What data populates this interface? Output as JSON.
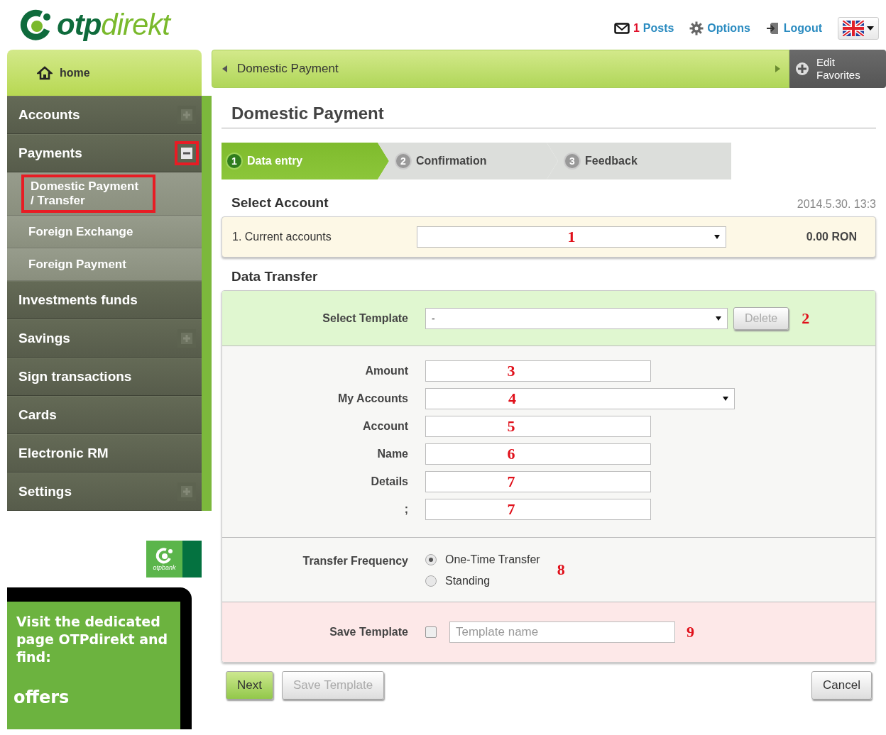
{
  "header": {
    "logo": {
      "mark": "otp",
      "word": "direkt"
    },
    "links": [
      {
        "kind": "posts",
        "count": "1",
        "label": "Posts"
      },
      {
        "kind": "options",
        "label": "Options"
      },
      {
        "kind": "logout",
        "label": "Logout"
      }
    ]
  },
  "sidebar": {
    "home": "home",
    "items": [
      {
        "label": "Accounts",
        "expandable": true,
        "expanded": false,
        "highlighted": false
      },
      {
        "label": "Payments",
        "expandable": true,
        "expanded": true,
        "highlighted": true,
        "children": [
          {
            "label": "Domestic Payment / Transfer",
            "highlighted": true
          },
          {
            "label": "Foreign Exchange",
            "highlighted": false
          },
          {
            "label": "Foreign Payment",
            "highlighted": false
          }
        ]
      },
      {
        "label": "Investments funds",
        "expandable": false,
        "expanded": false,
        "highlighted": false
      },
      {
        "label": "Savings",
        "expandable": true,
        "expanded": false,
        "highlighted": false
      },
      {
        "label": "Sign transactions",
        "expandable": false,
        "expanded": false,
        "highlighted": false
      },
      {
        "label": "Cards",
        "expandable": false,
        "expanded": false,
        "highlighted": false
      },
      {
        "label": "Electronic RM",
        "expandable": false,
        "expanded": false,
        "highlighted": false
      },
      {
        "label": "Settings",
        "expandable": true,
        "expanded": false,
        "highlighted": false
      }
    ],
    "bank_logo": "otpbank",
    "promo": {
      "text": "Visit the dedicated page OTPdirekt and find:",
      "cut_text": "offers"
    }
  },
  "breadcrumb": {
    "label": "Domestic Payment",
    "favorites": "Edit Favorites"
  },
  "page_title": "Domestic Payment",
  "steps": [
    {
      "number": "1",
      "label": "Data entry",
      "selected": true
    },
    {
      "number": "2",
      "label": "Confirmation",
      "selected": false
    },
    {
      "number": "3",
      "label": "Feedback",
      "selected": false
    }
  ],
  "select_account": {
    "title": "Select Account",
    "timestamp": "2014.5.30. 13:3",
    "account_label": "1. Current accounts",
    "annotation": "1",
    "balance": "0.00 RON"
  },
  "data_transfer": {
    "title": "Data Transfer",
    "template": {
      "label": "Select Template",
      "value": "-",
      "delete_button": "Delete",
      "delete_disabled": true,
      "annotation": "2"
    },
    "fields": [
      {
        "label": "Amount",
        "kind": "input",
        "annotation": "3"
      },
      {
        "label": "My Accounts",
        "kind": "select",
        "annotation": "4"
      },
      {
        "label": "Account",
        "kind": "input",
        "annotation": "5"
      },
      {
        "label": "Name",
        "kind": "input",
        "annotation": "6"
      },
      {
        "label": "Details",
        "kind": "input",
        "annotation": "7"
      },
      {
        "label": ";",
        "kind": "input",
        "annotation": "7"
      }
    ],
    "frequency": {
      "label": "Transfer Frequency",
      "annotation": "8",
      "options": [
        {
          "label": "One-Time Transfer",
          "selected": true
        },
        {
          "label": "Standing",
          "selected": false
        }
      ]
    },
    "save_template": {
      "label": "Save Template",
      "checked": false,
      "placeholder": "Template name",
      "annotation": "9"
    }
  },
  "buttons": [
    {
      "label": "Next",
      "kind": "primary",
      "disabled": false
    },
    {
      "label": "Save Template",
      "kind": "secondary",
      "disabled": true
    },
    {
      "label": "Cancel",
      "kind": "cancel",
      "disabled": false
    }
  ]
}
